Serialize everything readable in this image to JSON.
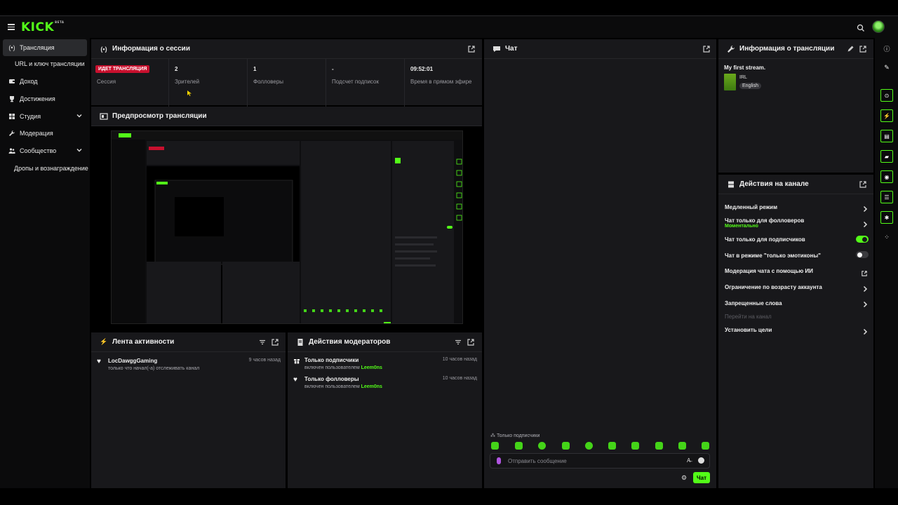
{
  "app": {
    "logo": "KICK",
    "logo_badge": "BETA"
  },
  "sidebar": {
    "items": [
      {
        "label": "Трансляция",
        "icon": "broadcast-icon"
      },
      {
        "label": "URL и ключ трансляции"
      },
      {
        "label": "Доход",
        "icon": "wallet-icon"
      },
      {
        "label": "Достижения",
        "icon": "trophy-icon"
      },
      {
        "label": "Студия",
        "icon": "studio-icon"
      },
      {
        "label": "Модерация",
        "icon": "wrench-icon"
      },
      {
        "label": "Сообщество",
        "icon": "community-icon"
      },
      {
        "label": "Дропы и вознаграждение"
      }
    ]
  },
  "session": {
    "title": "Информация о сессии",
    "live_badge": "ИДЕТ ТРАНСЛЯЦИЯ",
    "stats": [
      {
        "value": "",
        "label": "Сессия"
      },
      {
        "value": "2",
        "label": "Зрителей"
      },
      {
        "value": "1",
        "label": "Фолловеры"
      },
      {
        "value": "-",
        "label": "Подсчет подписок"
      },
      {
        "value": "09:52:01",
        "label": "Время в прямом эфире"
      }
    ]
  },
  "preview": {
    "title": "Предпросмотр трансляции"
  },
  "activity": {
    "title": "Лента активности",
    "items": [
      {
        "name": "LocDawggGaming",
        "desc": "только что начал(-а) отслеживать канал",
        "time": "9 часов назад"
      }
    ]
  },
  "mod_actions": {
    "title": "Действия модераторов",
    "items": [
      {
        "name": "Только подписчики",
        "desc": "включен пользователем",
        "user": "Leem0ns",
        "time": "10 часов назад"
      },
      {
        "name": "Только фолловеры",
        "desc": "включен пользователем",
        "user": "Leem0ns",
        "time": "10 часов назад"
      }
    ]
  },
  "chat": {
    "title": "Чат",
    "mode_label": "Только подписчики",
    "input_placeholder": "Отправить сообщение",
    "send_label": "Чат"
  },
  "stream_info": {
    "title": "Информация о трансляции",
    "stream_title": "My first stream.",
    "category": "IRL",
    "language": "English"
  },
  "channel_actions": {
    "title": "Действия на канале",
    "rows": [
      {
        "label": "Медленный режим",
        "control": "chevron"
      },
      {
        "label": "Чат только для фолловеров",
        "sub": "Моментально",
        "control": "chevron"
      },
      {
        "label": "Чат только для подписчиков",
        "control": "toggle",
        "on": true
      },
      {
        "label": "Чат в режиме \"только эмотиконы\"",
        "control": "toggle",
        "on": false
      },
      {
        "label": "Модерация чата с помощью ИИ",
        "control": "external"
      },
      {
        "label": "Ограничение по возрасту аккаунта",
        "control": "chevron"
      },
      {
        "label": "Запрещенные слова",
        "control": "chevron"
      },
      {
        "label": "Перейти на канал",
        "control": "none",
        "disabled": true
      },
      {
        "label": "Установить цели",
        "control": "chevron"
      }
    ]
  },
  "colors": {
    "accent": "#53fc18",
    "live": "#c8102e",
    "panel": "#18181b",
    "background": "#000000"
  }
}
